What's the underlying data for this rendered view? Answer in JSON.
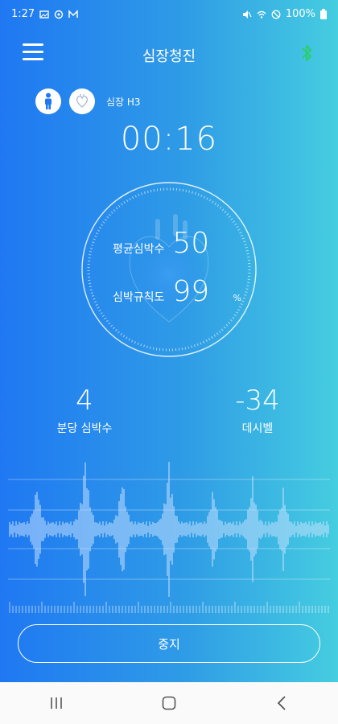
{
  "status": {
    "time": "1:27",
    "battery": "100%"
  },
  "app": {
    "title": "심장청진"
  },
  "device": {
    "name": "심장 H3"
  },
  "timer": "00:16",
  "dial": {
    "avg_label": "평균심박수",
    "avg_value": "50",
    "reg_label": "심박규칙도",
    "reg_value": "99",
    "reg_unit": "%"
  },
  "metrics": {
    "bpm_value": "4",
    "bpm_label": "분당 심박수",
    "db_value": "-34",
    "db_label": "데시벨"
  },
  "actions": {
    "stop_label": "중지"
  },
  "colors": {
    "grad_start": "#1f78f2",
    "grad_end": "#45cde0"
  }
}
